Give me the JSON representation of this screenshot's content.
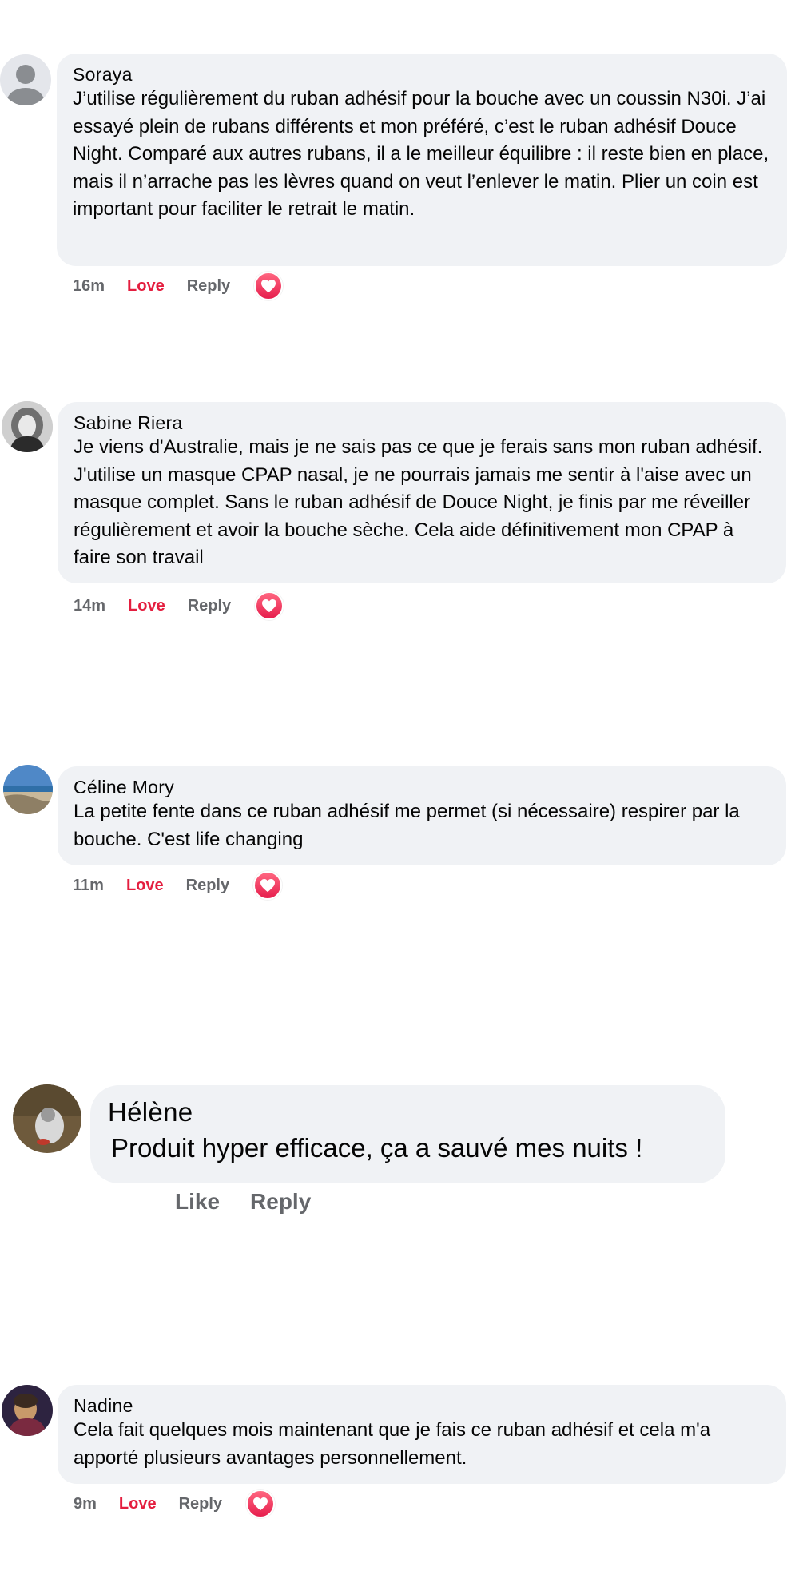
{
  "comments": [
    {
      "author": "Soraya",
      "text": "J’utilise régulièrement du ruban adhésif pour la bouche avec un coussin N30i. J’ai essayé plein de rubans différents et mon préféré, c’est le ruban adhésif Douce Night. Comparé aux autres rubans, il a le meilleur équilibre : il reste bien en place, mais il n’arrache pas les lèvres quand on veut l’enlever le matin. Plier un coin est important pour faciliter le retrait le matin.",
      "time": "16m",
      "reaction_label": "Love",
      "reply_label": "Reply",
      "reaction_icon": "heart-icon"
    },
    {
      "author": "Sabine Riera",
      "text": "Je viens d'Australie, mais je ne sais pas ce que je ferais sans mon ruban adhésif. J'utilise un masque CPAP nasal, je ne pourrais jamais me sentir à l'aise avec un masque complet. Sans le ruban adhésif de Douce Night, je finis par me réveiller régulièrement et avoir la bouche sèche. Cela aide définitivement mon CPAP à faire son travail",
      "time": "14m",
      "reaction_label": "Love",
      "reply_label": "Reply",
      "reaction_icon": "heart-icon"
    },
    {
      "author": "Céline Mory",
      "text": "La petite fente dans ce ruban adhésif me permet (si nécessaire) respirer par la bouche. C'est life changing",
      "time": "11m",
      "reaction_label": "Love",
      "reply_label": "Reply",
      "reaction_icon": "heart-icon"
    },
    {
      "author": "Hélène",
      "text": "Produit hyper efficace, ça a sauvé mes nuits !",
      "like_label": "Like",
      "reply_label": "Reply"
    },
    {
      "author": "Nadine",
      "text": "Cela fait quelques mois maintenant que je fais ce ruban adhésif et cela m'a apporté plusieurs avantages personnellement.",
      "time": "9m",
      "reaction_label": "Love",
      "reply_label": "Reply",
      "reaction_icon": "heart-icon"
    }
  ],
  "colors": {
    "bubble": "#f0f2f5",
    "love_red": "#e41e3f",
    "muted_gray": "#65676b"
  }
}
